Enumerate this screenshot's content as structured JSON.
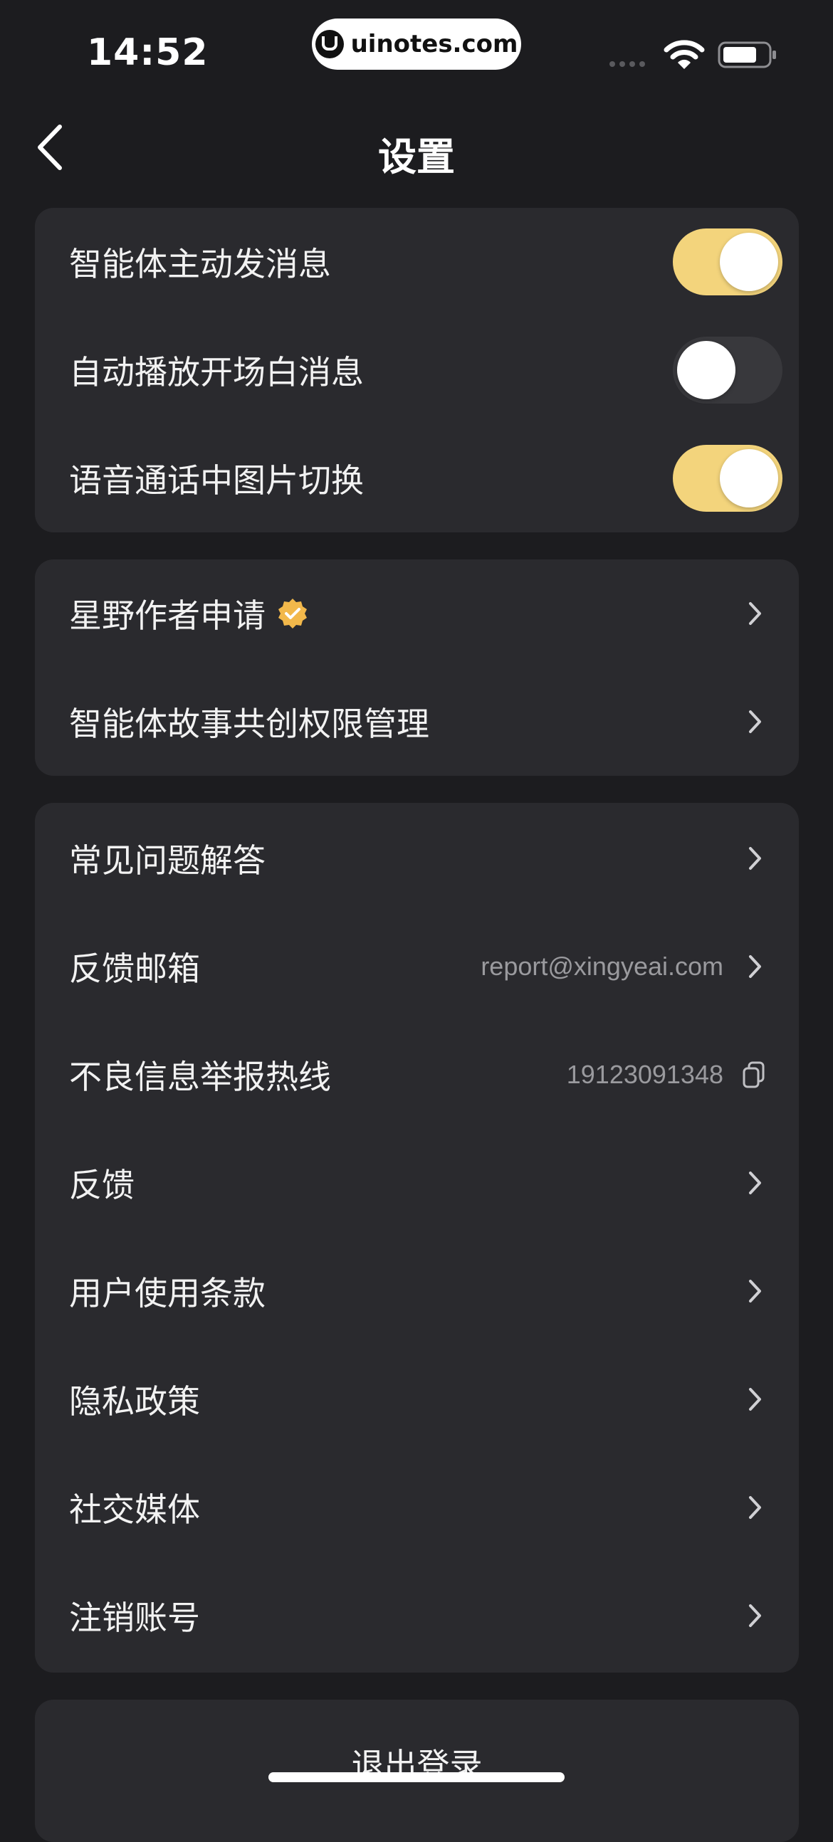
{
  "status_bar": {
    "time": "14:52",
    "watermark": "uinotes.com"
  },
  "nav": {
    "title": "设置"
  },
  "toggles_section": {
    "items": [
      {
        "label": "智能体主动发消息",
        "state": "on"
      },
      {
        "label": "自动播放开场白消息",
        "state": "off"
      },
      {
        "label": "语音通话中图片切换",
        "state": "on"
      }
    ]
  },
  "creator_section": {
    "items": [
      {
        "label": "星野作者申请",
        "badge_icon": "verified-badge-icon"
      },
      {
        "label": "智能体故事共创权限管理"
      }
    ]
  },
  "help_section": {
    "items": [
      {
        "label": "常见问题解答"
      },
      {
        "label": "反馈邮箱",
        "value": "report@xingyeai.com"
      },
      {
        "label": "不良信息举报热线",
        "value": "19123091348",
        "icon": "copy-icon"
      },
      {
        "label": "反馈"
      },
      {
        "label": "用户使用条款"
      },
      {
        "label": "隐私政策"
      },
      {
        "label": "社交媒体"
      },
      {
        "label": "注销账号"
      }
    ]
  },
  "logout": {
    "label": "退出登录"
  },
  "colors": {
    "background": "#1c1c1f",
    "card": "#2a2a2e",
    "toggle_on": "#f3d47c",
    "toggle_off": "#38383c",
    "badge": "#f2b84b"
  }
}
